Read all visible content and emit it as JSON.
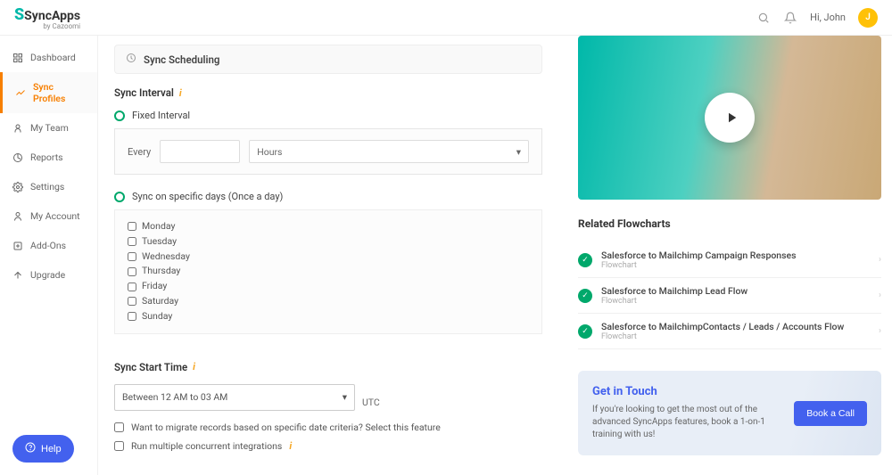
{
  "header": {
    "logo_main": "SyncApps",
    "logo_sub": "by Cazoomi",
    "greeting_prefix": "Hi,",
    "user_name": "John",
    "avatar_initial": "J"
  },
  "sidebar": {
    "items": [
      {
        "label": "Dashboard",
        "icon": "dashboard-icon"
      },
      {
        "label": "Sync Profiles",
        "icon": "sync-icon",
        "active": true
      },
      {
        "label": "My Team",
        "icon": "team-icon"
      },
      {
        "label": "Reports",
        "icon": "reports-icon"
      },
      {
        "label": "Settings",
        "icon": "settings-icon"
      },
      {
        "label": "My Account",
        "icon": "account-icon"
      },
      {
        "label": "Add-Ons",
        "icon": "addons-icon"
      },
      {
        "label": "Upgrade",
        "icon": "upgrade-icon"
      }
    ]
  },
  "main": {
    "section_title": "Sync Scheduling",
    "interval_label": "Sync Interval",
    "fixed_interval_label": "Fixed Interval",
    "every_label": "Every",
    "every_value": "",
    "unit_value": "Hours",
    "specific_days_label": "Sync on specific days (Once a day)",
    "days": [
      "Monday",
      "Tuesday",
      "Wednesday",
      "Thursday",
      "Friday",
      "Saturday",
      "Sunday"
    ],
    "start_time_label": "Sync Start Time",
    "start_time_value": "Between 12 AM to 03 AM",
    "utc_label": "UTC",
    "migrate_label": "Want to migrate records based on specific date criteria? Select this feature",
    "concurrent_label": "Run multiple concurrent integrations"
  },
  "right": {
    "related_title": "Related Flowcharts",
    "flowcharts": [
      {
        "title": "Salesforce to Mailchimp Campaign Responses",
        "sub": "Flowchart"
      },
      {
        "title": "Salesforce to Mailchimp Lead Flow",
        "sub": "Flowchart"
      },
      {
        "title": "Salesforce to MailchimpContacts / Leads / Accounts Flow",
        "sub": "Flowchart"
      }
    ],
    "touch_title": "Get in Touch",
    "touch_body": "If you're looking to get the most out of the advanced SyncApps features, book a 1-on-1 training with us!",
    "touch_btn": "Book a Call"
  },
  "help_label": "Help"
}
